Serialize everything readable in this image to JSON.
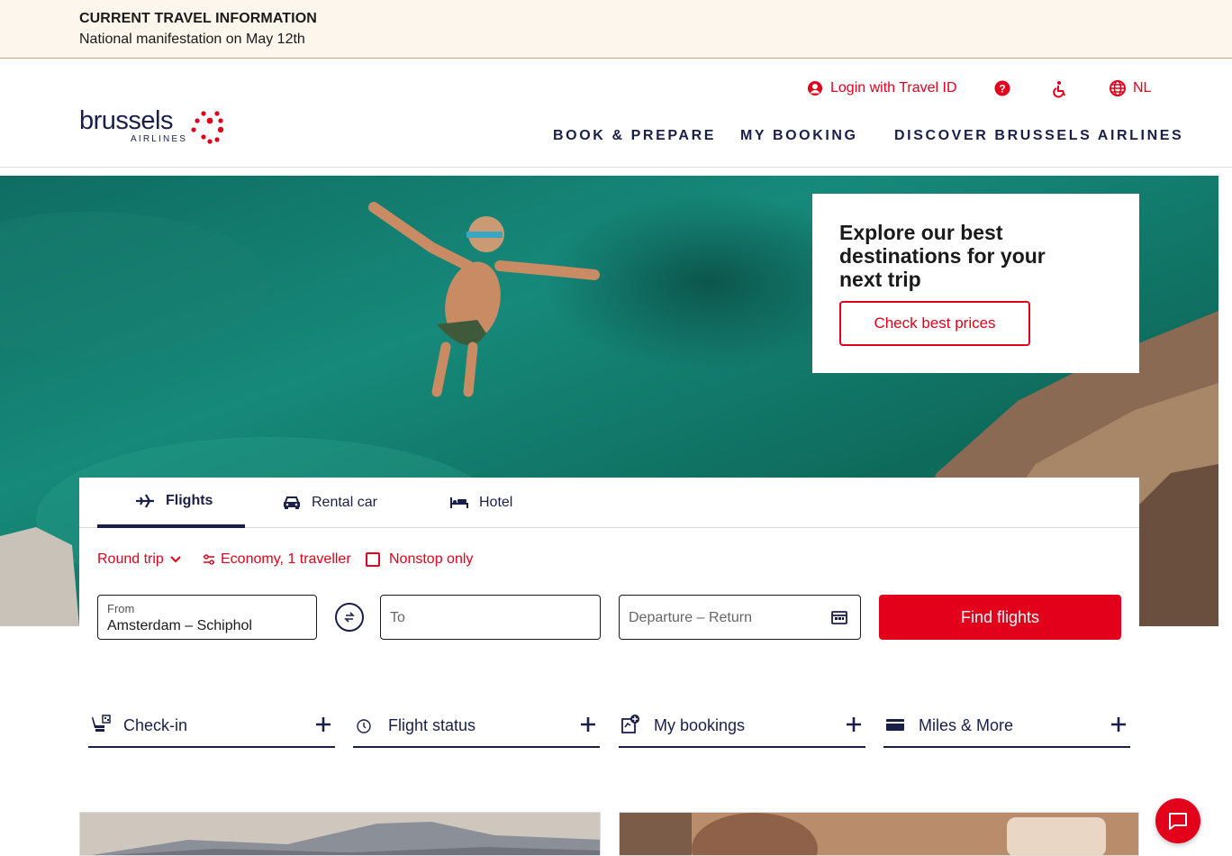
{
  "banner": {
    "title": "CURRENT TRAVEL INFORMATION",
    "text": "National manifestation on May 12th"
  },
  "logo": {
    "word": "brussels",
    "sub": "AIRLINES"
  },
  "util_nav": {
    "login": "Login with Travel ID",
    "language": "NL"
  },
  "main_nav": {
    "book": "BOOK & PREPARE",
    "booking": "MY BOOKING",
    "discover": "DISCOVER BRUSSELS AIRLINES"
  },
  "promo": {
    "title": "Explore our best destinations for your next trip",
    "button": "Check best prices"
  },
  "tabs": {
    "flights": "Flights",
    "car": "Rental car",
    "hotel": "Hotel"
  },
  "options": {
    "trip_type": "Round trip",
    "cabin": "Economy, 1 traveller",
    "nonstop": "Nonstop only"
  },
  "search": {
    "from_label": "From",
    "from_value": "Amsterdam – Schiphol",
    "to_placeholder": "To",
    "dates_placeholder": "Departure – Return",
    "find": "Find flights"
  },
  "quick_links": {
    "checkin": "Check-in",
    "status": "Flight status",
    "bookings": "My bookings",
    "miles": "Miles & More"
  },
  "colors": {
    "brand_red": "#e2001a",
    "navy": "#1a1f4a",
    "banner_bg": "#fdf6ec"
  }
}
